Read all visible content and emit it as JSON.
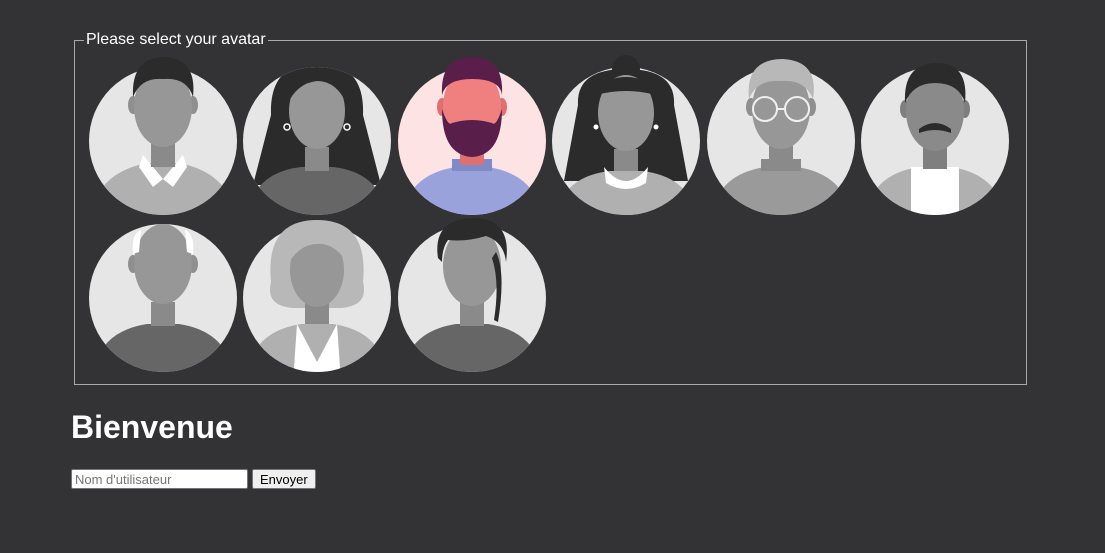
{
  "avatar_selector": {
    "legend": "Please select your avatar",
    "avatars": [
      {
        "name": "man-collar",
        "selected": false
      },
      {
        "name": "woman-long-hair-earrings",
        "selected": false
      },
      {
        "name": "man-beard",
        "selected": true
      },
      {
        "name": "woman-bun-collar",
        "selected": false
      },
      {
        "name": "man-glasses",
        "selected": false
      },
      {
        "name": "man-mustache",
        "selected": false
      },
      {
        "name": "bald-man",
        "selected": false
      },
      {
        "name": "woman-bob",
        "selected": false
      },
      {
        "name": "man-side-part",
        "selected": false
      }
    ]
  },
  "welcome": {
    "title": "Bienvenue"
  },
  "login_form": {
    "username_placeholder": "Nom d'utilisateur",
    "username_value": "",
    "submit_label": "Envoyer"
  },
  "colors": {
    "background": "#333335",
    "avatar_bg": "#e6e6e6",
    "selected_bg": "#fde3e3",
    "selected_skin": "#f08080",
    "selected_hair": "#5a1e4a",
    "selected_shirt": "#9aa2db"
  }
}
